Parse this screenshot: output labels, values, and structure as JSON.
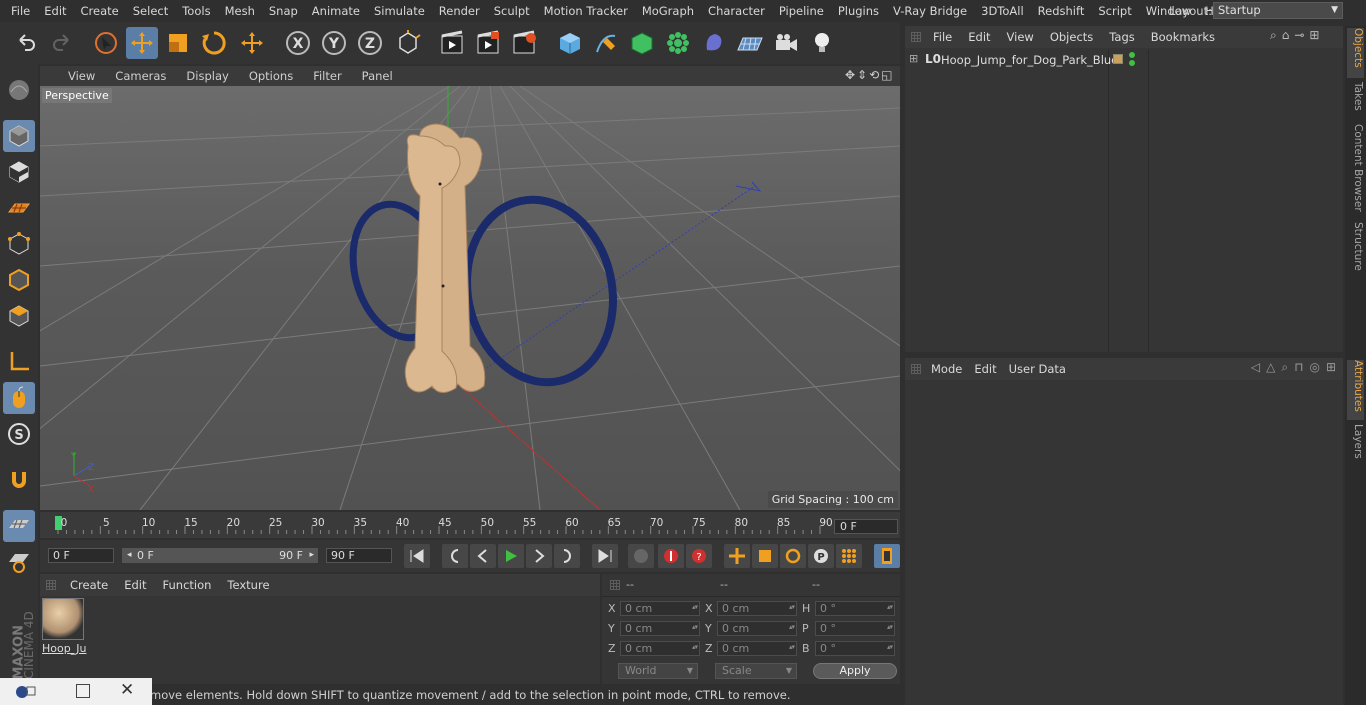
{
  "menu": [
    "File",
    "Edit",
    "Create",
    "Select",
    "Tools",
    "Mesh",
    "Snap",
    "Animate",
    "Simulate",
    "Render",
    "Sculpt",
    "Motion Tracker",
    "MoGraph",
    "Character",
    "Pipeline",
    "Plugins",
    "V-Ray Bridge",
    "3DToAll",
    "Redshift",
    "Script",
    "Window",
    "Help"
  ],
  "layout": {
    "label": "Layout:",
    "value": "Startup"
  },
  "viewport": {
    "menu": [
      "View",
      "Cameras",
      "Display",
      "Options",
      "Filter",
      "Panel"
    ],
    "label": "Perspective",
    "grid_spacing": "Grid Spacing : 100 cm"
  },
  "timeline": {
    "ticks": [
      "0",
      "5",
      "10",
      "15",
      "20",
      "25",
      "30",
      "35",
      "40",
      "45",
      "50",
      "55",
      "60",
      "65",
      "70",
      "75",
      "80",
      "85",
      "90"
    ],
    "current_frame": "0 F"
  },
  "transport": {
    "start": "0 F",
    "range_start": "0 F",
    "range_end": "90 F",
    "end": "90 F"
  },
  "material": {
    "menu": [
      "Create",
      "Edit",
      "Function",
      "Texture"
    ],
    "name": "Hoop_Ju"
  },
  "coords": {
    "header": [
      "--",
      "--",
      "--"
    ],
    "pos_labels": [
      "X",
      "Y",
      "Z"
    ],
    "size_labels": [
      "X",
      "Y",
      "Z"
    ],
    "rot_labels": [
      "H",
      "P",
      "B"
    ],
    "pos": [
      "0 cm",
      "0 cm",
      "0 cm"
    ],
    "size": [
      "0 cm",
      "0 cm",
      "0 cm"
    ],
    "rot": [
      "0 °",
      "0 °",
      "0 °"
    ],
    "mode": "World",
    "scale": "Scale",
    "apply": "Apply"
  },
  "status": "move elements. Hold down SHIFT to quantize movement / add to the selection in point mode, CTRL to remove.",
  "objects": {
    "menu": [
      "File",
      "Edit",
      "View",
      "Objects",
      "Tags",
      "Bookmarks"
    ],
    "items": [
      {
        "name": "Hoop_Jump_for_Dog_Park_Blue"
      }
    ]
  },
  "attributes": {
    "menu": [
      "Mode",
      "Edit",
      "User Data"
    ]
  },
  "side_tabs": [
    "Objects",
    "Takes",
    "Content Browser",
    "Structure",
    "Attributes",
    "Layers"
  ],
  "brand": {
    "line1": "MAXON",
    "line2": "CINEMA 4D"
  },
  "colors": {
    "accent": "#5a7ea6",
    "hoop": "#1a2a6a",
    "bone": "#d4b088"
  }
}
